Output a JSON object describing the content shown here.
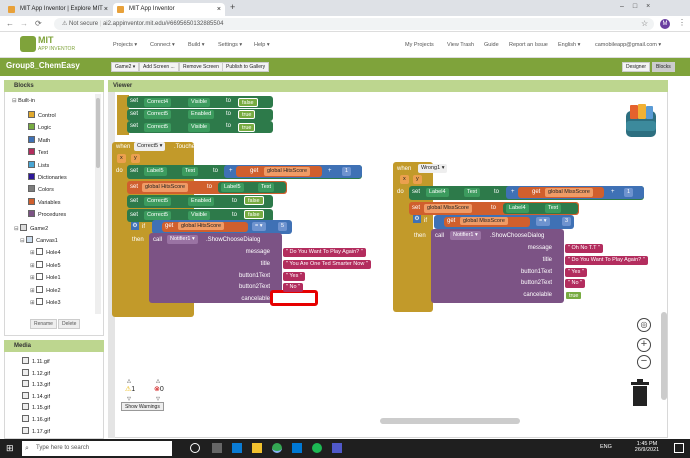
{
  "browser": {
    "tabs": [
      {
        "label": "MIT App Inventor | Explore MIT"
      },
      {
        "label": "MIT App Inventor"
      }
    ],
    "new_tab": "+",
    "not_secure": "Not secure",
    "url": "ai2.appinventor.mit.edu/#6695650132885504",
    "profile": "M"
  },
  "header": {
    "logo_line1": "MIT",
    "logo_line2": "APP INVENTOR",
    "menus": [
      "Projects ▾",
      "Connect ▾",
      "Build ▾",
      "Settings ▾",
      "Help ▾"
    ],
    "right_links": [
      "My Projects",
      "View Trash",
      "Guide",
      "Report an Issue",
      "English ▾",
      "camobileapp@gmail.com ▾"
    ]
  },
  "project_bar": {
    "title": "Group8_ChemEasy",
    "screen_select": "Game2 ▾",
    "add_screen": "Add Screen ...",
    "remove_screen": "Remove Screen",
    "publish": "Publish to Gallery",
    "designer": "Designer",
    "blocks": "Blocks"
  },
  "blocks_panel": {
    "title": "Blocks",
    "builtin": "Built-in",
    "builtin_items": [
      {
        "label": "Control",
        "color": "#e1a92d"
      },
      {
        "label": "Logic",
        "color": "#77ab41"
      },
      {
        "label": "Math",
        "color": "#3f71b5"
      },
      {
        "label": "Text",
        "color": "#b32d5e"
      },
      {
        "label": "Lists",
        "color": "#49a6d4"
      },
      {
        "label": "Dictionaries",
        "color": "#2d1799"
      },
      {
        "label": "Colors",
        "color": "#7d7d7d"
      },
      {
        "label": "Variables",
        "color": "#d05f2d"
      },
      {
        "label": "Procedures",
        "color": "#7c5385"
      }
    ],
    "screen": "Game2",
    "canvas": "Canvas1",
    "canvas_items": [
      "Hole4",
      "Hole5",
      "Hole1",
      "Hole2",
      "Hole3"
    ],
    "rename": "Rename",
    "delete": "Delete"
  },
  "media_panel": {
    "title": "Media",
    "files": [
      "1.11.gif",
      "1.12.gif",
      "1.13.gif",
      "1.14.gif",
      "1.15.gif",
      "1.16.gif",
      "1.17.gif"
    ]
  },
  "viewer": {
    "title": "Viewer",
    "warnings_count": "1",
    "errors_count": "0",
    "show_warnings": "Show Warnings"
  },
  "top_stack": [
    {
      "comp": "Correct4",
      "prop": "Visible",
      "val": "false"
    },
    {
      "comp": "Correct5",
      "prop": "Enabled",
      "val": "true"
    },
    {
      "comp": "Correct5",
      "prop": "Visible",
      "val": "true"
    }
  ],
  "left_event": {
    "when": "when",
    "comp": "Correct5",
    "event": ".Touched",
    "x": "x",
    "y": "y",
    "do": "do",
    "set": "set",
    "to": "to",
    "get": "get",
    "plus": "+",
    "one": "1",
    "label": "Label5",
    "text_prop": "Text",
    "global_var": "global HitsScore",
    "c5": "Correct5",
    "enabled": "Enabled",
    "visible": "Visible",
    "false": "false",
    "if": "if",
    "then": "then",
    "gt": "= ▾",
    "five": "5",
    "call": "call",
    "notifier": "Notifier1",
    "method": ".ShowChooseDialog",
    "params": [
      "message",
      "title",
      "button1Text",
      "button2Text",
      "cancelable"
    ],
    "message": "Do You Want To Play Again?",
    "title": "You Are One Ted Smarter Now",
    "button1": "Yes",
    "button2": "No"
  },
  "right_event": {
    "when": "when",
    "comp": "Wrong1",
    "event": ".Touched",
    "x": "x",
    "y": "y",
    "do": "do",
    "set": "set",
    "to": "to",
    "get": "get",
    "plus": "+",
    "one": "1",
    "label": "Label4",
    "text_prop": "Text",
    "global_var": "global MissScore",
    "if": "if",
    "then": "then",
    "gt": "= ▾",
    "three": "3",
    "call": "call",
    "notifier": "Notifier1",
    "method": ".ShowChooseDialog",
    "params": [
      "message",
      "title",
      "button1Text",
      "button2Text",
      "cancelable"
    ],
    "message": "Oh No T.T",
    "title": "Do You Want To Play Again?",
    "button1": "Yes",
    "button2": "No",
    "cancelable": "true"
  },
  "taskbar": {
    "search": "Type here to search",
    "lang": "ENG",
    "time": "1:45 PM",
    "date": "26/9/2021"
  }
}
